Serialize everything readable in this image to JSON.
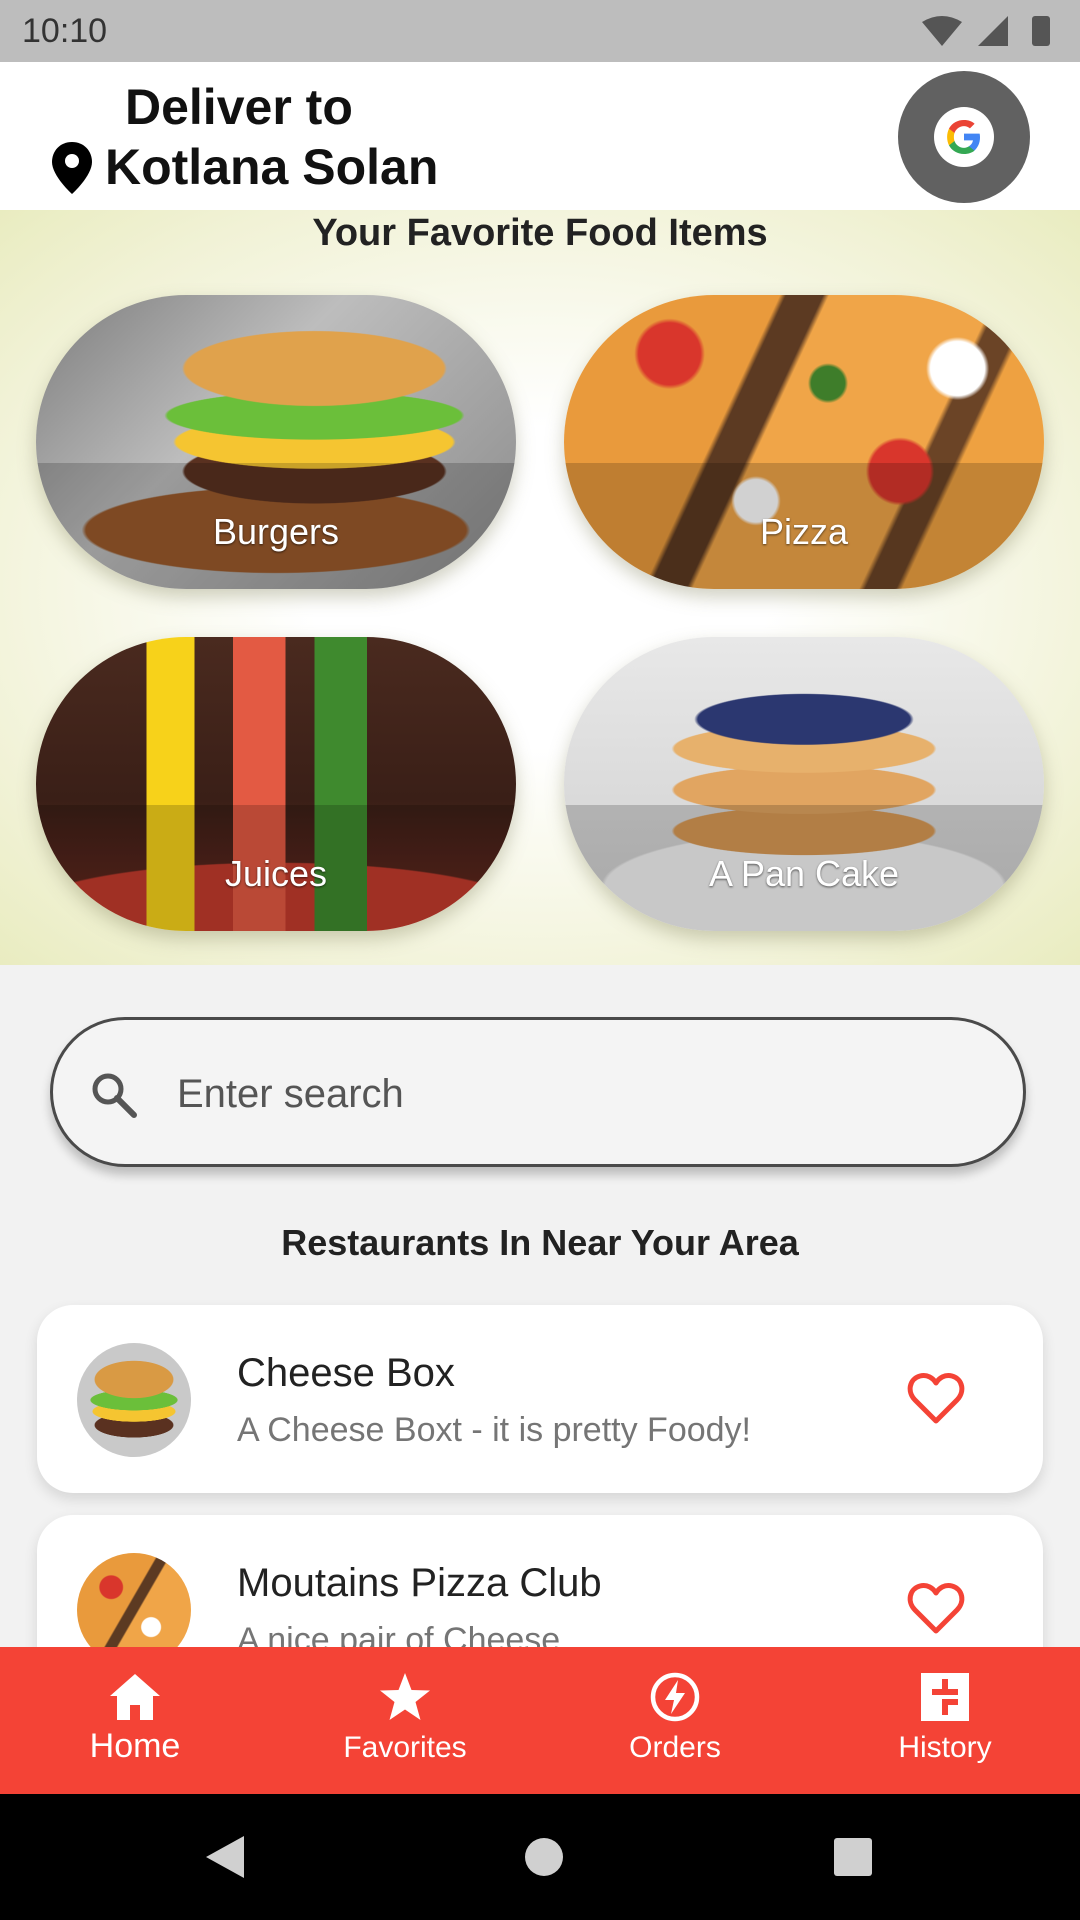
{
  "status_bar": {
    "time": "10:10"
  },
  "header": {
    "deliver_label": "Deliver to",
    "location": "Kotlana Solan",
    "account_icon": "google-icon"
  },
  "favorites": {
    "title": "Your Favorite Food Items",
    "items": [
      {
        "label": "Burgers"
      },
      {
        "label": "Pizza"
      },
      {
        "label": "Juices"
      },
      {
        "label": "A Pan Cake"
      }
    ]
  },
  "search": {
    "placeholder": "Enter search",
    "value": ""
  },
  "restaurants": {
    "title": "Restaurants In Near Your Area",
    "items": [
      {
        "name": "Cheese Box",
        "description": "A Cheese Boxt - it is pretty Foody!"
      },
      {
        "name": "Moutains Pizza Club",
        "description": "A nice pair of Cheese"
      }
    ]
  },
  "bottom_nav": {
    "items": [
      {
        "label": "Home",
        "icon": "home-icon"
      },
      {
        "label": "Favorites",
        "icon": "star-icon"
      },
      {
        "label": "Orders",
        "icon": "lightning-icon"
      },
      {
        "label": "History",
        "icon": "history-icon"
      }
    ]
  },
  "colors": {
    "accent": "#f44336",
    "favorite_heart": "#f44336",
    "header_background": "#ffffff",
    "status_bar": "#bdbdbd"
  }
}
